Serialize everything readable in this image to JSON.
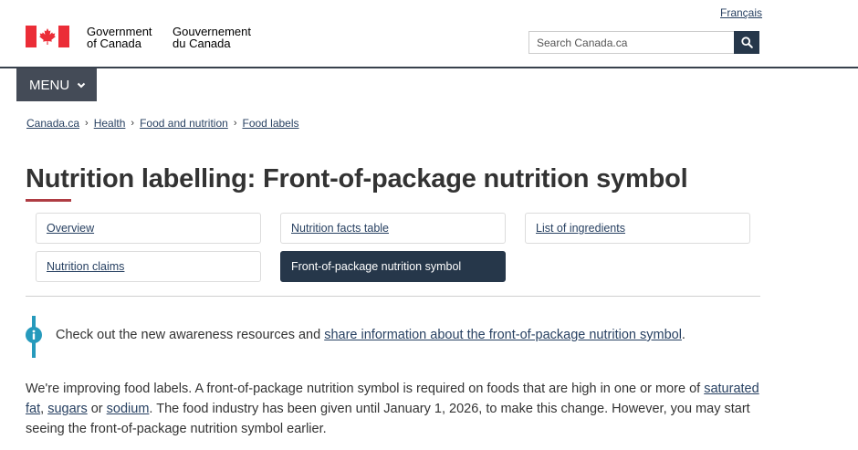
{
  "header": {
    "language_link": "Français",
    "wordmark_en_line1": "Government",
    "wordmark_en_line2": "of Canada",
    "wordmark_fr_line1": "Gouvernement",
    "wordmark_fr_line2": "du Canada",
    "search_placeholder": "Search Canada.ca",
    "menu_label": "MENU"
  },
  "breadcrumb": [
    "Canada.ca",
    "Health",
    "Food and nutrition",
    "Food labels"
  ],
  "page_title": "Nutrition labelling: Front-of-package nutrition symbol",
  "tabs": [
    {
      "label": "Overview"
    },
    {
      "label": "Nutrition facts table"
    },
    {
      "label": "List of ingredients"
    },
    {
      "label": "Nutrition claims"
    },
    {
      "label": "Front-of-package nutrition symbol",
      "active": true
    }
  ],
  "alert": {
    "prefix": "Check out the new awareness resources and ",
    "link": "share information about the front-of-package nutrition symbol",
    "suffix": "."
  },
  "intro": {
    "text1": "We're improving food labels. A front-of-package nutrition symbol is required on foods that are high in one or more of ",
    "link1": "saturated fat",
    "sep1": ", ",
    "link2": "sugars",
    "sep2": " or ",
    "link3": "sodium",
    "text2": ". The food industry has been given until January 1, 2026, to make this change. However, you may start seeing the front-of-package nutrition symbol earlier."
  },
  "colors": {
    "nav_dark": "#26374a",
    "menu_bg": "#444b57",
    "link": "#284162",
    "accent_red": "#af3c43",
    "info_blue": "#269abc"
  }
}
